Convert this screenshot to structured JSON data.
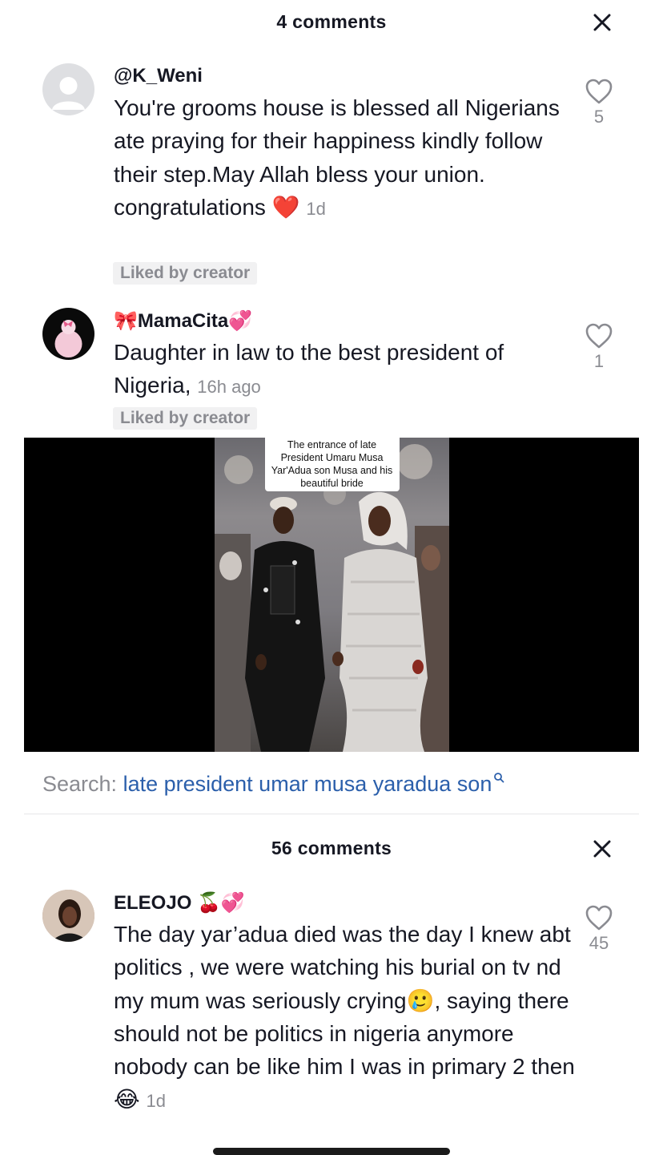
{
  "sheet_top": {
    "title": "4 comments"
  },
  "comments_top": [
    {
      "username": "@K_Weni",
      "text": "You're grooms house is blessed all Nigerians ate praying for their happiness kindly follow their step.May Allah bless your union. congratulations ❤️",
      "time": "1d",
      "liked_by_creator": "Liked by creator",
      "likes": "5"
    },
    {
      "username": "🎀MamaCita💞",
      "text": "Daughter in law to the best president of Nigeria,",
      "time": "16h ago",
      "liked_by_creator": "Liked by creator",
      "likes": "1"
    }
  ],
  "video": {
    "caption": "The entrance of late President Umaru Musa Yar'Adua son Musa and his beautiful bride"
  },
  "search": {
    "prefix": "Search:",
    "query": "late president umar musa yaradua son"
  },
  "sheet_bottom": {
    "title": "56 comments"
  },
  "comments_bottom": [
    {
      "username": "ELEOJO 🍒💞",
      "text": "The day yar’adua died was the day I knew abt politics , we were watching his burial on tv nd my mum was seriously crying🥲, saying there should not be politics in nigeria anymore nobody can be like him I was in primary 2 then 😂",
      "time": "1d",
      "likes": "45"
    }
  ],
  "icons": {
    "close": "close-icon",
    "like": "heart-outline-icon",
    "search": "search-icon",
    "avatar_default": "default-avatar-icon"
  },
  "colors": {
    "text": "#161823",
    "muted": "#8a8b91",
    "search_link": "#2b5fab",
    "liked_badge_bg": "#f1f1f2"
  }
}
